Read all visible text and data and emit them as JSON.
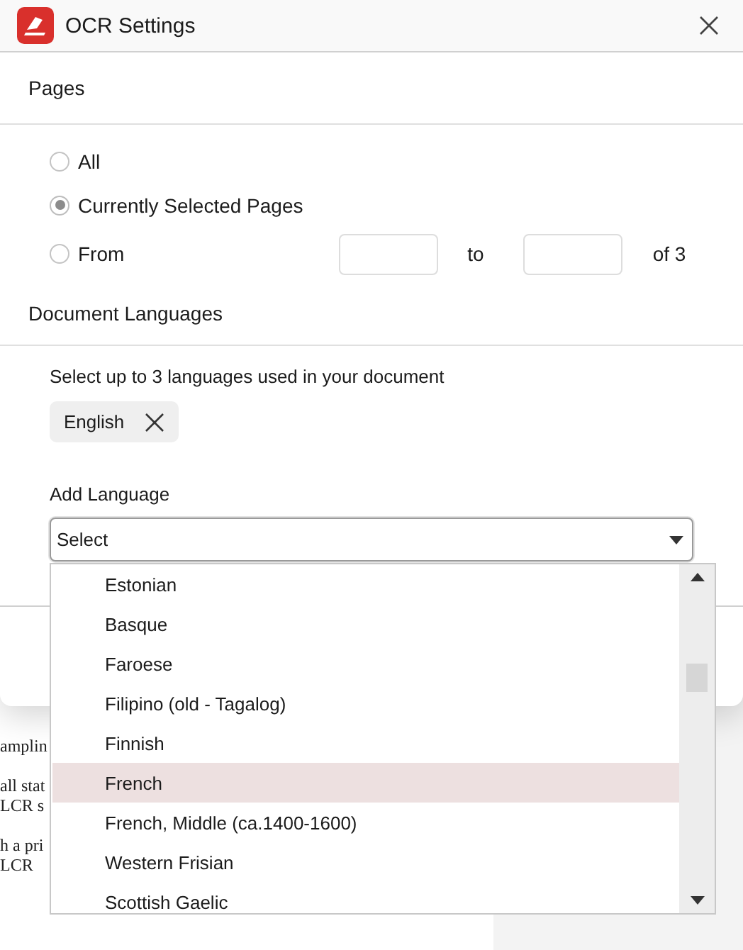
{
  "document": {
    "paragraphs": [
      [
        "amplin"
      ],
      [
        "all stat",
        "LCR s"
      ],
      [
        "h a pri",
        "LCR"
      ]
    ]
  },
  "dialog": {
    "title": "OCR Settings",
    "pages": {
      "heading": "Pages",
      "options": [
        {
          "label": "All",
          "selected": false,
          "kind": "plain"
        },
        {
          "label": "Currently Selected Pages",
          "selected": true,
          "kind": "plain"
        },
        {
          "label": "From",
          "selected": false,
          "kind": "range",
          "to_label": "to",
          "of_label": "of 3"
        }
      ]
    },
    "languages": {
      "heading": "Document Languages",
      "hint": "Select up to 3 languages used in your document",
      "chips": [
        "English"
      ],
      "add_label": "Add Language",
      "select": {
        "value": "Select",
        "expanded": true
      },
      "options": [
        {
          "label": "Estonian",
          "selected": false
        },
        {
          "label": "Basque",
          "selected": false
        },
        {
          "label": "Faroese",
          "selected": false
        },
        {
          "label": "Filipino (old - Tagalog)",
          "selected": false
        },
        {
          "label": "Finnish",
          "selected": false
        },
        {
          "label": "French",
          "selected": true
        },
        {
          "label": "French, Middle (ca.1400-1600)",
          "selected": false
        },
        {
          "label": "Western Frisian",
          "selected": false
        },
        {
          "label": "Scottish Gaelic",
          "selected": false
        }
      ]
    }
  }
}
